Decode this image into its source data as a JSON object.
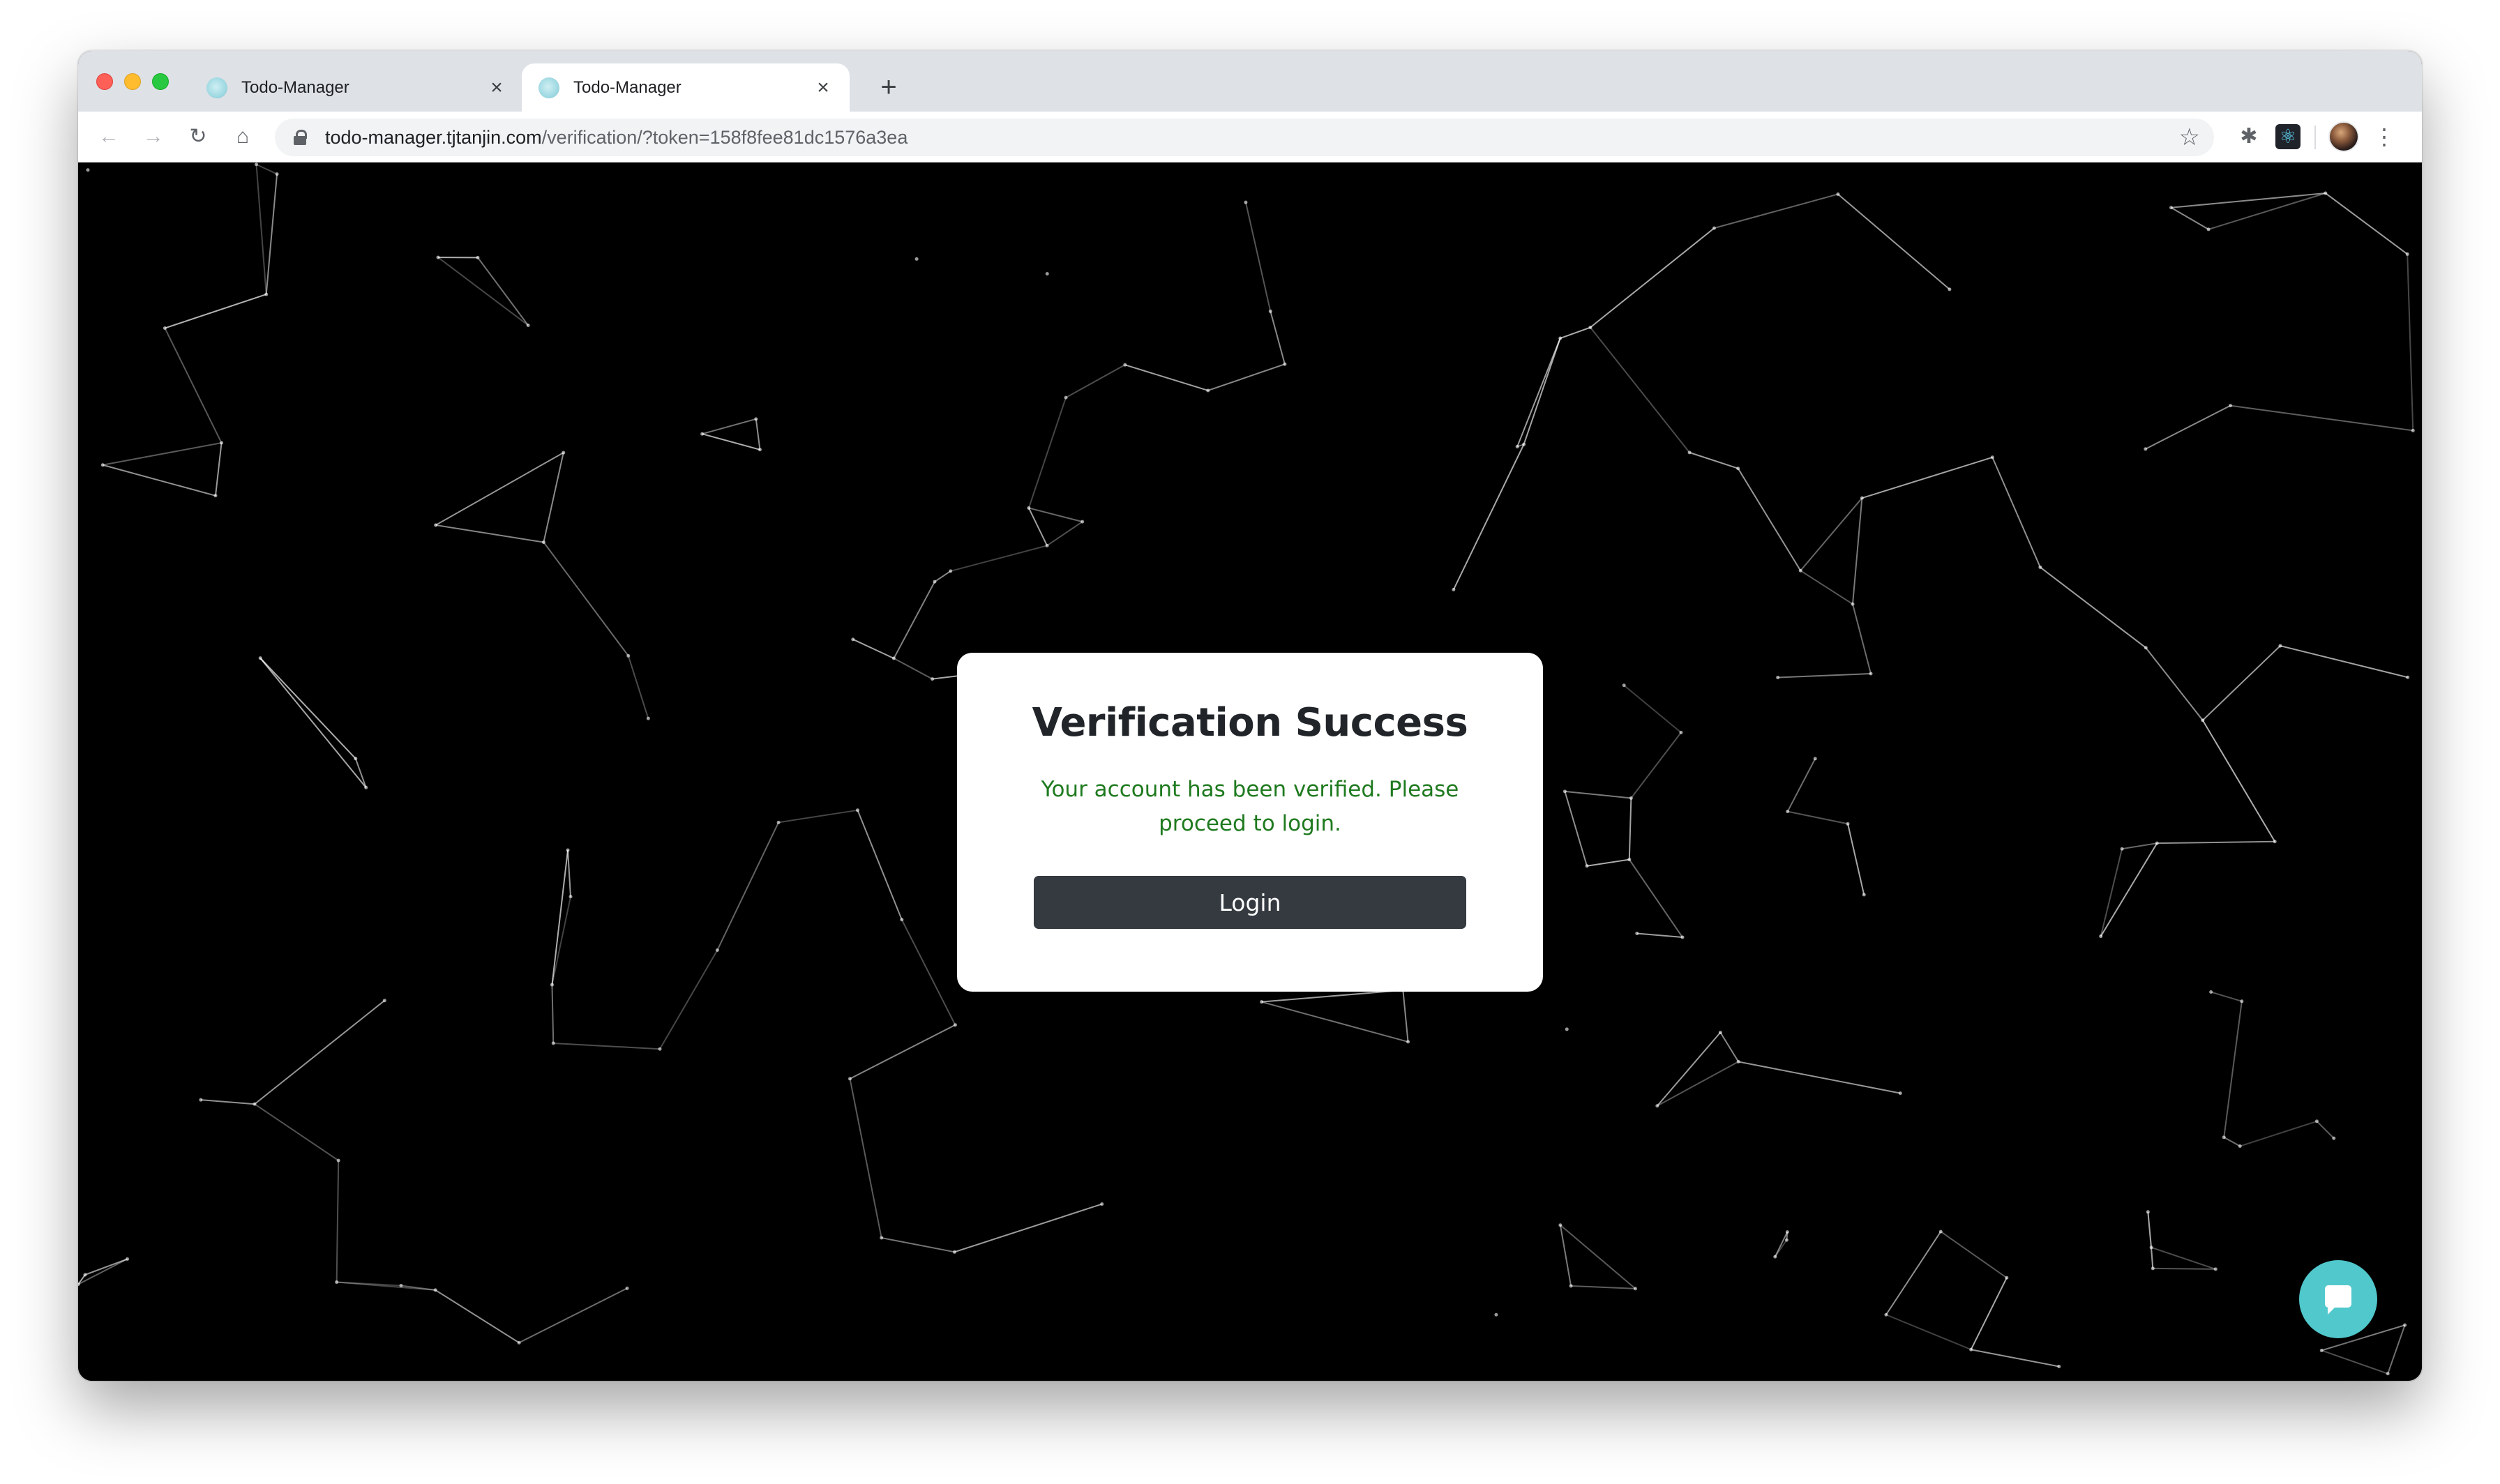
{
  "browser": {
    "tabs": [
      {
        "title": "Todo-Manager",
        "close_glyph": "×",
        "active": false
      },
      {
        "title": "Todo-Manager",
        "close_glyph": "×",
        "active": true
      }
    ],
    "new_tab_glyph": "+",
    "url": {
      "host": "todo-manager.tjtanjin.com",
      "path": "/verification/?token=158f8fee81dc1576a3ea"
    },
    "icons": {
      "back": "←",
      "forward": "→",
      "reload": "↻",
      "home": "⌂",
      "star": "☆",
      "puzzle": "✱",
      "react": "⚛",
      "menu": "⋮"
    }
  },
  "modal": {
    "title": "Verification Success",
    "message": "Your account has been verified. Please proceed to login.",
    "button_label": "Login"
  },
  "colors": {
    "background": "#000000",
    "message_green": "#1f7a1f",
    "button_dark": "#343a40",
    "chat_teal": "#50c8cc"
  }
}
